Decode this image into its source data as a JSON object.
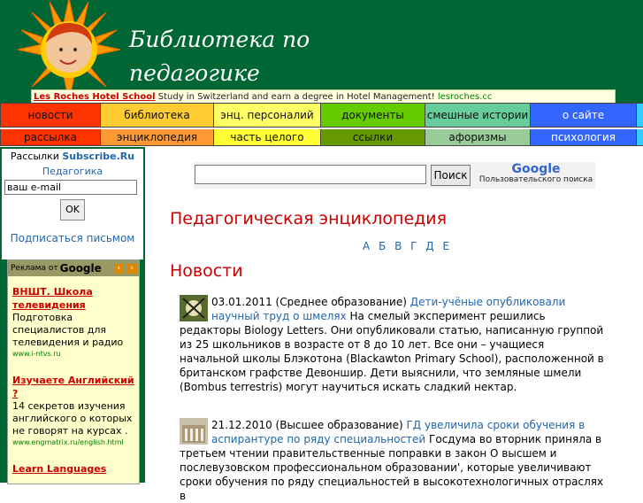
{
  "site": {
    "title_line1": "Библиотека по",
    "title_line2": "педагогике"
  },
  "top_ad": {
    "link": "Les Roches Hotel School",
    "text": " Study in Switzerland and earn a degree in Hotel Management!",
    "url": " lesroches.cc"
  },
  "menu_row1": [
    {
      "label": "новости",
      "color": "#ff3300"
    },
    {
      "label": "библиотека",
      "color": "#ffcc33"
    },
    {
      "label": "энц. персоналий",
      "color": "#ffff66"
    },
    {
      "label": "документы",
      "color": "#66cc00"
    },
    {
      "label": "смешные истории",
      "color": "#66cc99"
    },
    {
      "label": "о сайте",
      "color": "#3366ff"
    }
  ],
  "menu_row2": [
    {
      "label": "рассылка",
      "color": "#ff3300"
    },
    {
      "label": "энциклопедия",
      "color": "#ff9933"
    },
    {
      "label": "часть целого",
      "color": "#ffff33"
    },
    {
      "label": "ссылки",
      "color": "#669900"
    },
    {
      "label": "афоризмы",
      "color": "#99cc99"
    },
    {
      "label": "психология",
      "color": "#3366ff"
    }
  ],
  "subscribe": {
    "prefix": "Рассылки ",
    "brand": "Subscribe.Ru",
    "category": "Педагогика",
    "email_value": "ваш e-mail",
    "ok": "OK",
    "by_letter": "Подписаться письмом"
  },
  "google_ads": {
    "header_prefix": "Реклама от ",
    "header_brand": "Google",
    "prev": "‹",
    "next": "›",
    "items": [
      {
        "title": "ВНШТ. Школа телевидения",
        "body": "Подготовка специалистов для телевидения и радио",
        "url": "www.i-ntvs.ru"
      },
      {
        "title": "Изучаете Английский ?",
        "body": "14 секретов изучения английского о которых не говорят на курсах .",
        "url": "www.engmatrix.ru/english.html"
      },
      {
        "title": "Learn Languages",
        "body": "",
        "url": ""
      }
    ]
  },
  "search": {
    "button": "Поиск",
    "brand": "Google",
    "caption": "Пользовательского поиска"
  },
  "encyclopedia": {
    "title": "Педагогическая энциклопедия",
    "letters": "А Б В Г Д Е"
  },
  "news": {
    "title": "Новости",
    "items": [
      {
        "date": "03.01.2011",
        "category": " (Среднее образование) ",
        "link": "Дети-учёные опубликовали научный труд о шмелях",
        "text": "  На смелый эксперимент решились редакторы  Biology Letters. Они опубликовали статью, написанную группой из   25 школьников в возрасте от 8 до 10 лет. Все они – учащиеся начальной школы Блэкотона   (Blackawton   Primary   School), расположенной в британском графстве Девоншир. Дети выяснили, что земляные шмели  (Bombus terrestris) могут научиться искать сладкий нектар."
      },
      {
        "date": "21.12.2010",
        "category": "  (Высшее образование)    ",
        "link": "ГД увеличила сроки обучения в аспирантуре по ряду специальностей",
        "text": "   Госдума во вторник приняла в третьем чтении правительственные поправки в закон  О высшем и послевузовском профессиональном образовании', которые увеличивают сроки обучения по ряду специальностей в высокотехнологичных отраслях в"
      }
    ]
  }
}
